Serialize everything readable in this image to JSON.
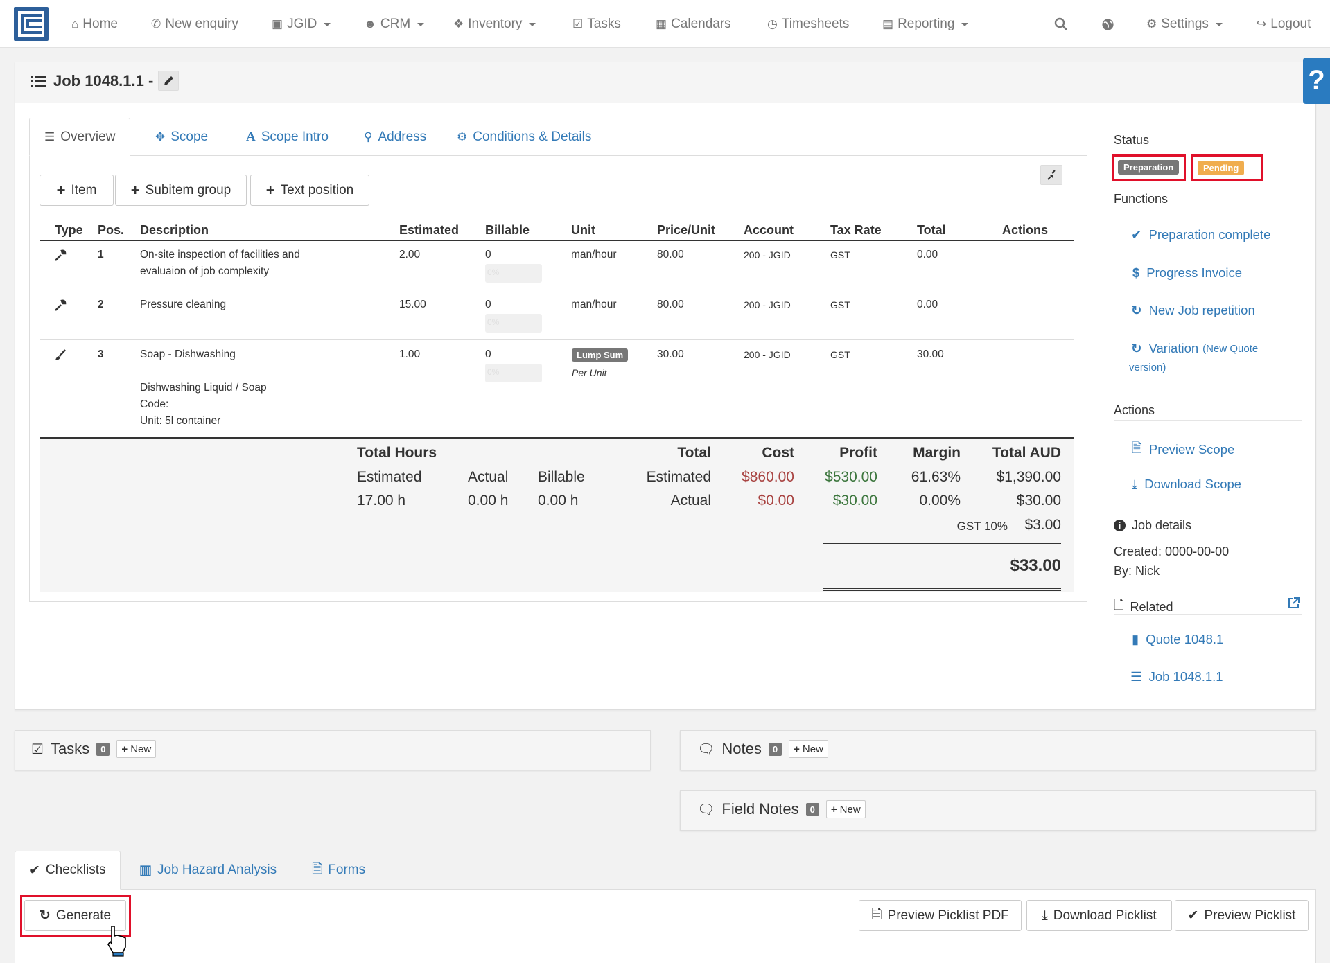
{
  "nav": {
    "home": "Home",
    "new_enquiry": "New enquiry",
    "jgid": "JGID",
    "crm": "CRM",
    "inventory": "Inventory",
    "tasks": "Tasks",
    "calendars": "Calendars",
    "timesheets": "Timesheets",
    "reporting": "Reporting",
    "settings": "Settings",
    "logout": "Logout"
  },
  "page": {
    "title": "Job 1048.1.1 -"
  },
  "tabs": [
    "Overview",
    "Scope",
    "Scope Intro",
    "Address",
    "Conditions & Details"
  ],
  "toolbar": {
    "item": "Item",
    "subitem_group": "Subitem group",
    "text_position": "Text position"
  },
  "table": {
    "headers": [
      "Type",
      "Pos.",
      "Description",
      "Estimated",
      "Billable",
      "Unit",
      "Price/Unit",
      "Account",
      "Tax Rate",
      "Total",
      "Actions"
    ],
    "rows": [
      {
        "type_icon": "wrench-icon",
        "pos": "1",
        "description": "On-site inspection of facilities and",
        "description2": "evaluaion of job complexity",
        "estimated": "2.00",
        "billable": "0",
        "progress": "0%",
        "unit": "man/hour",
        "price": "80.00",
        "account": "200 - JGID",
        "tax": "GST",
        "total": "0.00"
      },
      {
        "type_icon": "wrench-icon",
        "pos": "2",
        "description": "Pressure cleaning",
        "estimated": "15.00",
        "billable": "0",
        "progress": "0%",
        "unit": "man/hour",
        "price": "80.00",
        "account": "200 - JGID",
        "tax": "GST",
        "total": "0.00"
      },
      {
        "type_icon": "brush-icon",
        "pos": "3",
        "description": "Soap - Dishwashing",
        "extra": [
          "Dishwashing Liquid / Soap",
          "Code:",
          "Unit: 5l container"
        ],
        "estimated": "1.00",
        "billable": "0",
        "progress": "0%",
        "unit_badge": "Lump Sum",
        "unit_sub": "Per Unit",
        "price": "30.00",
        "account": "200 - JGID",
        "tax": "GST",
        "total": "30.00"
      }
    ]
  },
  "totals": {
    "hours_title": "Total Hours",
    "estimated_label": "Estimated",
    "actual_label": "Actual",
    "billable_label": "Billable",
    "est_hours": "17.00 h",
    "act_hours": "0.00 h",
    "bill_hours": "0.00 h",
    "total_title": "Total",
    "cost_title": "Cost",
    "profit_title": "Profit",
    "margin_title": "Margin",
    "total_aud_title": "Total AUD",
    "est_row_label": "Estimated",
    "act_row_label": "Actual",
    "est_cost": "$860.00",
    "est_profit": "$530.00",
    "est_margin": "61.63%",
    "est_total": "$1,390.00",
    "act_cost": "$0.00",
    "act_profit": "$30.00",
    "act_margin": "0.00%",
    "act_total": "$30.00",
    "gst_label": "GST 10%",
    "gst_value": "$3.00",
    "grand_total": "$33.00"
  },
  "sidebar": {
    "status_title": "Status",
    "status_labels": [
      "Preparation",
      "Pending"
    ],
    "functions_title": "Functions",
    "functions": [
      "Preparation complete",
      "Progress Invoice",
      "New Job repetition",
      "Variation"
    ],
    "variation_note": "(New Quote",
    "variation_note2": "version)",
    "actions_title": "Actions",
    "actions": [
      "Preview Scope",
      "Download Scope"
    ],
    "job_details_title": "Job details",
    "created": "Created: 0000-00-00",
    "by": "By: Nick",
    "related_title": "Related",
    "related": [
      "Quote 1048.1",
      "Job 1048.1.1"
    ]
  },
  "panels": {
    "tasks": {
      "title": "Tasks",
      "count": "0",
      "new": "New"
    },
    "notes": {
      "title": "Notes",
      "count": "0",
      "new": "New"
    },
    "field_notes": {
      "title": "Field Notes",
      "count": "0",
      "new": "New"
    }
  },
  "bottom_tabs": [
    "Checklists",
    "Job Hazard Analysis",
    "Forms"
  ],
  "bottom_buttons": {
    "generate": "Generate",
    "preview_picklist_pdf": "Preview Picklist PDF",
    "download_picklist": "Download Picklist",
    "preview_picklist": "Preview Picklist"
  },
  "colors": {
    "brand": "#2d5f9a",
    "link": "#337ab7",
    "label_default": "#777777",
    "label_warning": "#f0ad4e",
    "cost_red": "#a94442",
    "profit_green": "#3c763d",
    "highlight_red": "#e0102a"
  }
}
